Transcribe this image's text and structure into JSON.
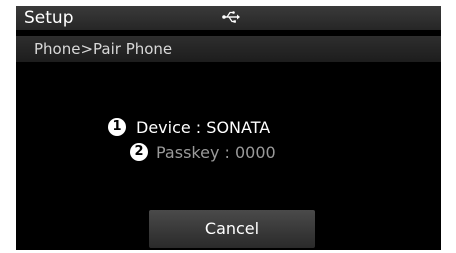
{
  "header": {
    "title": "Setup",
    "status_icon": "usb-icon"
  },
  "breadcrumb": "Phone>Pair Phone",
  "info": {
    "device": {
      "marker": "1",
      "text": "Device : SONATA"
    },
    "passkey": {
      "marker": "2",
      "text": "Passkey : 0000"
    }
  },
  "actions": {
    "cancel_label": "Cancel"
  },
  "colors": {
    "background": "#000000",
    "primary_text": "#ffffff",
    "secondary_text": "#9a9a9a"
  }
}
